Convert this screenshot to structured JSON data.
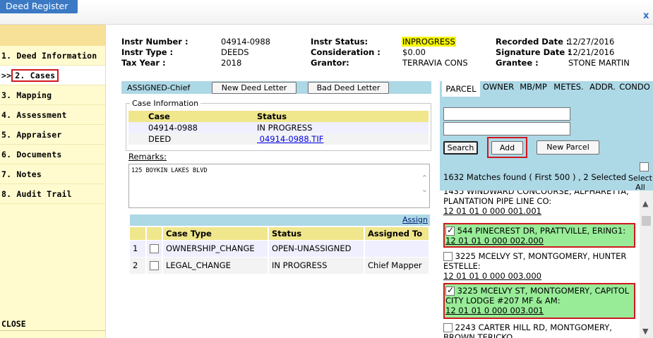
{
  "app": {
    "title": "Deed Register",
    "close_glyph": "x"
  },
  "nav": {
    "items": [
      {
        "label": "1. Deed Information"
      },
      {
        "label": "2. Cases",
        "prefix": ">>"
      },
      {
        "label": "3. Mapping"
      },
      {
        "label": "4. Assessment"
      },
      {
        "label": "5. Appraiser"
      },
      {
        "label": "6. Documents"
      },
      {
        "label": "7. Notes"
      },
      {
        "label": "8. Audit Trail"
      }
    ],
    "close": "CLOSE"
  },
  "header": {
    "instr_number_label": "Instr Number :",
    "instr_number": "04914-0988",
    "instr_type_label": "Instr Type :",
    "instr_type": "DEEDS",
    "tax_year_label": "Tax Year :",
    "tax_year": "2018",
    "instr_status_label": "Instr Status:",
    "instr_status": "INPROGRESS",
    "consideration_label": "Consideration :",
    "consideration": "$0.00",
    "grantor_label": "Grantor:",
    "grantor": "TERRAVIA CONS",
    "recorded_date_label": "Recorded Date :",
    "recorded_date": "12/27/2016",
    "signature_date_label": "Signature Date :",
    "signature_date": "12/21/2016",
    "grantee_label": "Grantee :",
    "grantee": "STONE MARTIN"
  },
  "cases": {
    "assigned": "ASSIGNED-Chief",
    "new_deed_letter": "New Deed Letter",
    "bad_deed_letter": "Bad Deed Letter",
    "case_info_legend": "Case Information",
    "case_table": {
      "headers": [
        "Case",
        "Status"
      ],
      "rows": [
        [
          "04914-0988",
          "IN PROGRESS"
        ],
        [
          "DEED",
          " 04914-0988.TIF"
        ]
      ]
    },
    "remarks_label": "Remarks:",
    "remarks": "125 BOYKIN LAKES BLVD",
    "assign_link": "Assign",
    "assign_table": {
      "headers": [
        "Case Type",
        "Status",
        "Assigned To"
      ],
      "rows": [
        {
          "num": "1",
          "type": "OWNERSHIP_CHANGE",
          "status": "OPEN-UNASSIGNED",
          "assigned": ""
        },
        {
          "num": "2",
          "type": "LEGAL_CHANGE",
          "status": "IN PROGRESS",
          "assigned": "Chief Mapper"
        }
      ]
    }
  },
  "parcel": {
    "tabs": [
      "PARCEL",
      "OWNER",
      "MB/MP",
      "METES.",
      "ADDR.",
      "CONDO"
    ],
    "search_label": "Search",
    "add_label": "Add",
    "new_parcel_label": "New Parcel",
    "matches": "1632 Matches found ( First 500 ) , 2 Selected",
    "select_all": "Select All",
    "results": [
      {
        "text": "1435 WINDWARD CONCOURSE, ALPHARETTA, PLANTATION PIPE LINE CO:",
        "num": "12 01 01 0 000 001.001"
      },
      {
        "text": "544 PINECREST DR,  PRATTVILLE, ERING1:",
        "num": "12 01 01 0 000 002.000"
      },
      {
        "text": "3225 MCELVY ST,  MONTGOMERY, HUNTER ESTELLE:",
        "num": "12 01 01 0 000 003.000"
      },
      {
        "text": "3225 MCELVY ST,  MONTGOMERY, CAPITOL CITY LODGE #207 MF & AM:",
        "num": "12 01 01 0 000 003.001"
      },
      {
        "text": "2243 CARTER HILL RD,  MONTGOMERY, BROWN TERICKO",
        "num": ""
      }
    ]
  }
}
